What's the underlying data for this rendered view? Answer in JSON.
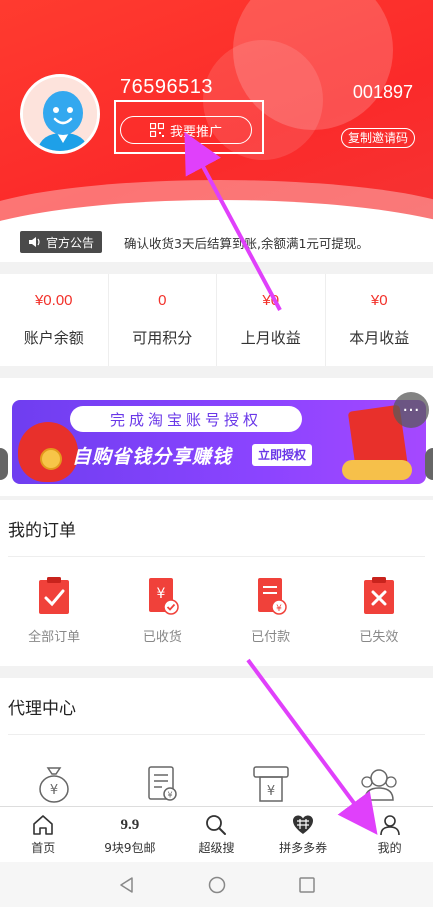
{
  "header": {
    "username": "76596513",
    "promote_label": "我要推广",
    "invite_code": "001897",
    "copy_label": "复制邀请码"
  },
  "notice": {
    "tag": "官方公告",
    "text": "确认收货3天后结算到账,余额满1元可提现。"
  },
  "stats": [
    {
      "value": "¥0.00",
      "label": "账户余额"
    },
    {
      "value": "0",
      "label": "可用积分"
    },
    {
      "value": "¥0",
      "label": "上月收益"
    },
    {
      "value": "¥0",
      "label": "本月收益"
    }
  ],
  "banner": {
    "pill": "完成淘宝账号授权",
    "main": "自购省钱分享赚钱",
    "cta": "立即授权",
    "more": "···"
  },
  "orders": {
    "title": "我的订单",
    "items": [
      {
        "label": "全部订单",
        "icon": "clipboard-check-icon"
      },
      {
        "label": "已收货",
        "icon": "received-icon"
      },
      {
        "label": "已付款",
        "icon": "paid-icon"
      },
      {
        "label": "已失效",
        "icon": "expired-icon"
      }
    ]
  },
  "agent": {
    "title": "代理中心",
    "icons": [
      "money-bag-icon",
      "bill-icon",
      "atm-icon",
      "team-icon"
    ]
  },
  "nav": [
    {
      "label": "首页",
      "icon": "home-icon"
    },
    {
      "label": "9块9包邮",
      "icon": "nine-nine-icon",
      "glyph": "9.9"
    },
    {
      "label": "超级搜",
      "icon": "search-icon"
    },
    {
      "label": "拼多多券",
      "icon": "pdd-icon"
    },
    {
      "label": "我的",
      "icon": "profile-icon"
    }
  ],
  "colors": {
    "header": "#fb2a2a",
    "accent": "#f2312a",
    "banner": "#7b40f5",
    "arrow": "#e040fb"
  }
}
